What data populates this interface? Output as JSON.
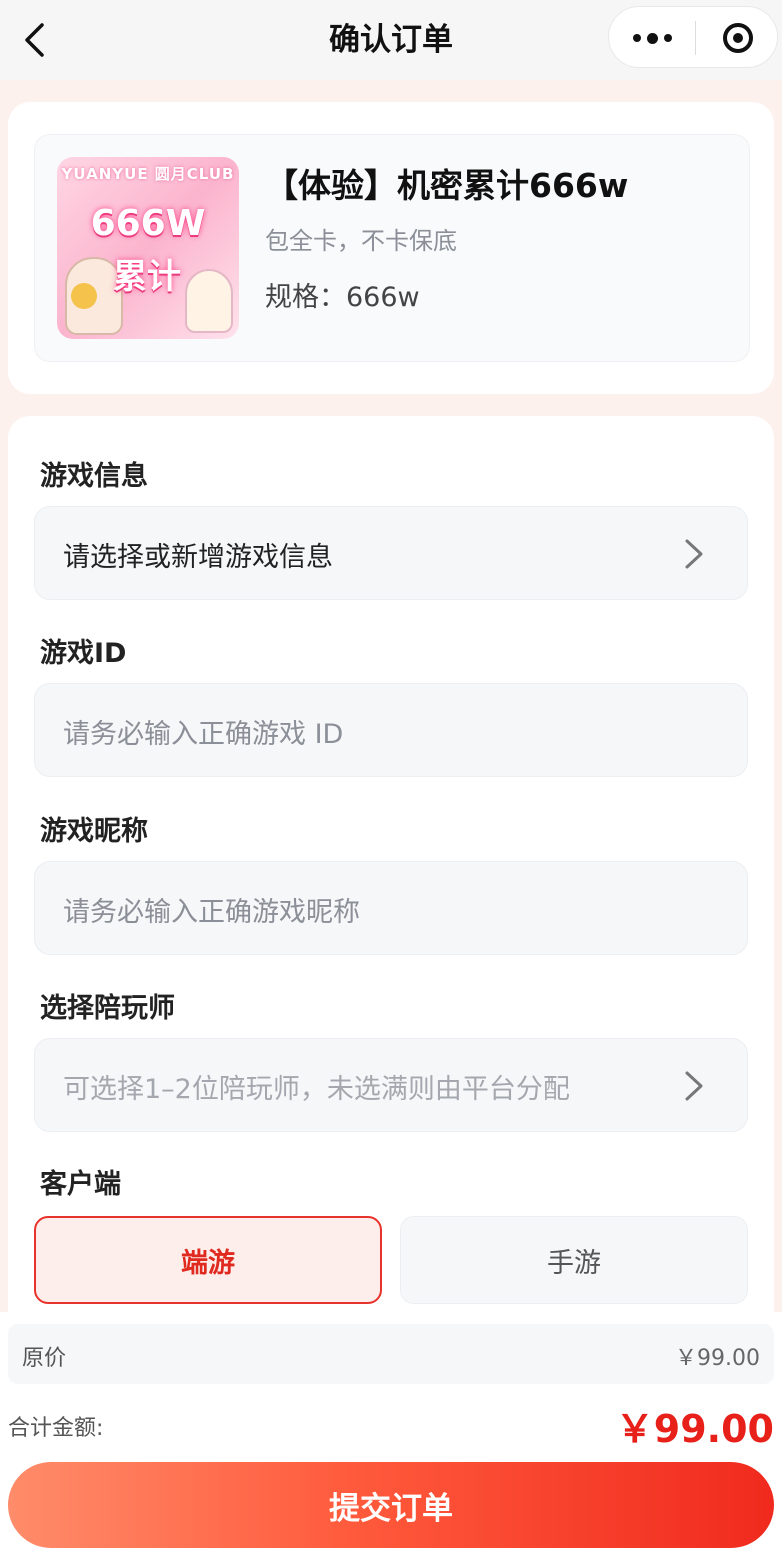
{
  "nav": {
    "title": "确认订单"
  },
  "product": {
    "thumb_brand": "YUANYUE 圆月CLUB",
    "thumb_big": "666W",
    "thumb_sub": "累计",
    "title": "【体验】机密累计666w",
    "desc": "包全卡，不卡保底",
    "spec": "规格：666w"
  },
  "form": {
    "game_info": {
      "label": "游戏信息",
      "value": "请选择或新增游戏信息"
    },
    "game_id": {
      "label": "游戏ID",
      "placeholder": "请务必输入正确游戏 ID"
    },
    "nickname": {
      "label": "游戏昵称",
      "placeholder": "请务必输入正确游戏昵称"
    },
    "companion": {
      "label": "选择陪玩师",
      "placeholder": "可选择1–2位陪玩师，未选满则由平台分配"
    },
    "client": {
      "label": "客户端",
      "options": [
        "端游",
        "手游"
      ],
      "selected": "端游"
    }
  },
  "summary": {
    "original_label": "原价",
    "original_value": "￥99.00",
    "total_label": "合计金额:",
    "total_value": "￥99.00",
    "submit_label": "提交订单"
  },
  "colors": {
    "accent": "#e8201a",
    "selected_bg": "#fdeeec",
    "page_bg": "#fdf1ee"
  },
  "icons": [
    "back-arrow-icon",
    "more-dots-icon",
    "target-close-icon",
    "chevron-right-icon"
  ]
}
